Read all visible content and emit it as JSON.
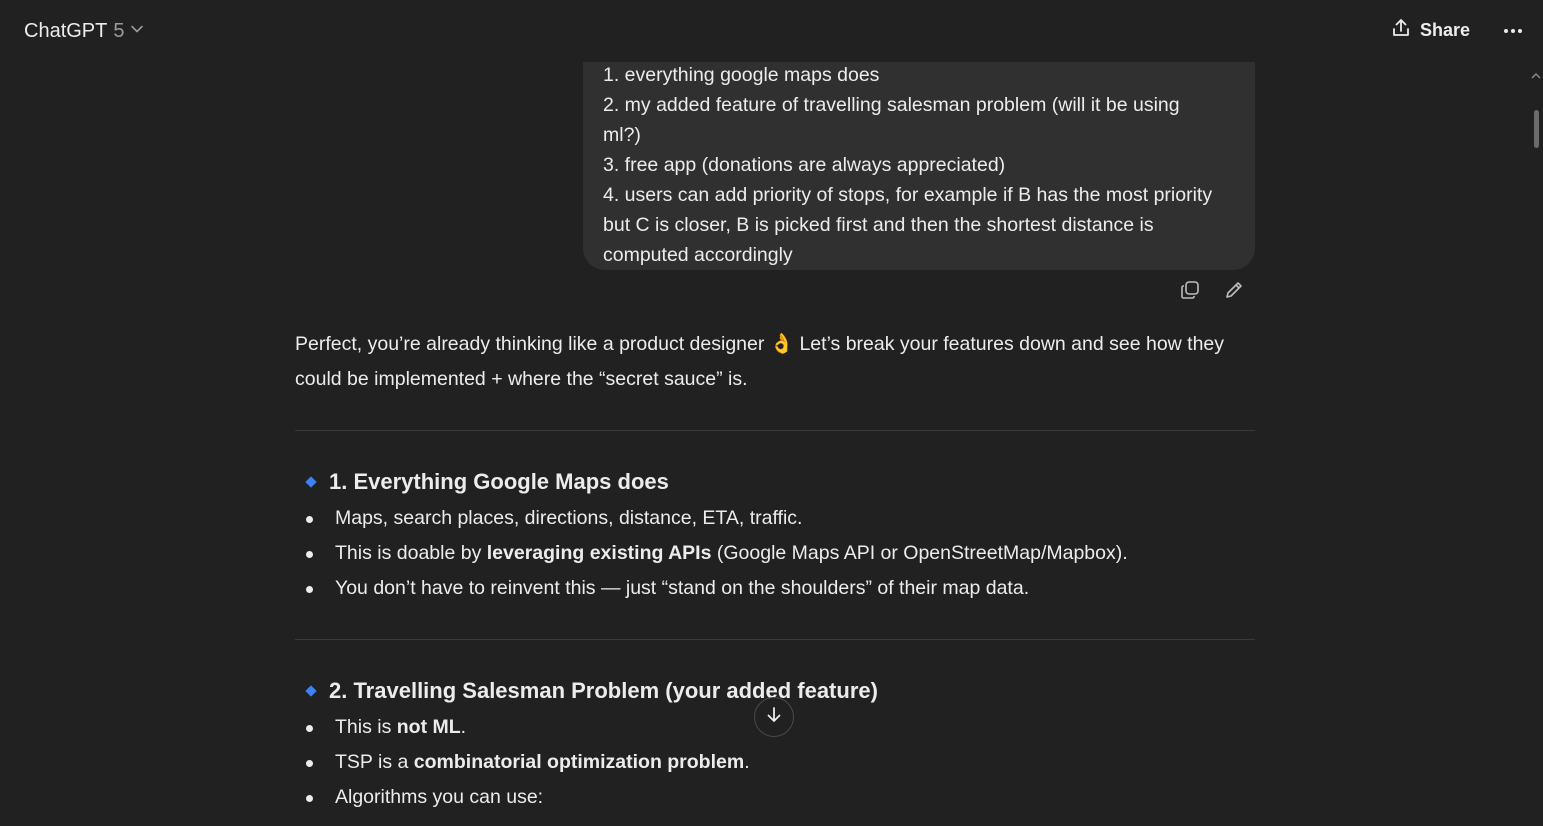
{
  "header": {
    "model_name": "ChatGPT",
    "model_version": "5",
    "share_label": "Share"
  },
  "user_message": {
    "lines": [
      "1. everything google maps does",
      "2. my added feature of travelling salesman problem (will it be using",
      "ml?)",
      "3. free app (donations are always appreciated)",
      "4. users can add priority of stops, for example if B has the most priority",
      "but C is closer, B is picked first and then the shortest distance is",
      "computed accordingly"
    ]
  },
  "assistant": {
    "intro_a": "Perfect, you’re already thinking like a product designer 👌 Let’s break your features down and see how they",
    "intro_b": "could be implemented + where the “secret sauce” is.",
    "section1": {
      "title": "1. Everything Google Maps does",
      "b1": "Maps, search places, directions, distance, ETA, traffic.",
      "b2_pre": "This is doable by ",
      "b2_bold": "leveraging existing APIs",
      "b2_post": " (Google Maps API or OpenStreetMap/Mapbox).",
      "b3": "You don’t have to reinvent this — just “stand on the shoulders” of their map data."
    },
    "section2": {
      "title": "2. Travelling Salesman Problem (your added feature)",
      "b1_pre": "This is ",
      "b1_bold": "not ML",
      "b1_post": ".",
      "b2_pre": "TSP is a ",
      "b2_bold": "combinatorial optimization problem",
      "b2_post": ".",
      "b3": "Algorithms you can use:"
    }
  },
  "colors": {
    "background": "#212121",
    "bubble": "#303030",
    "accent_diamond": "#3b82f6",
    "text": "#ececec"
  },
  "icons": [
    "chevron-down-icon",
    "share-icon",
    "more-icon",
    "copy-icon",
    "edit-icon",
    "diamond-icon",
    "arrow-down-icon"
  ]
}
